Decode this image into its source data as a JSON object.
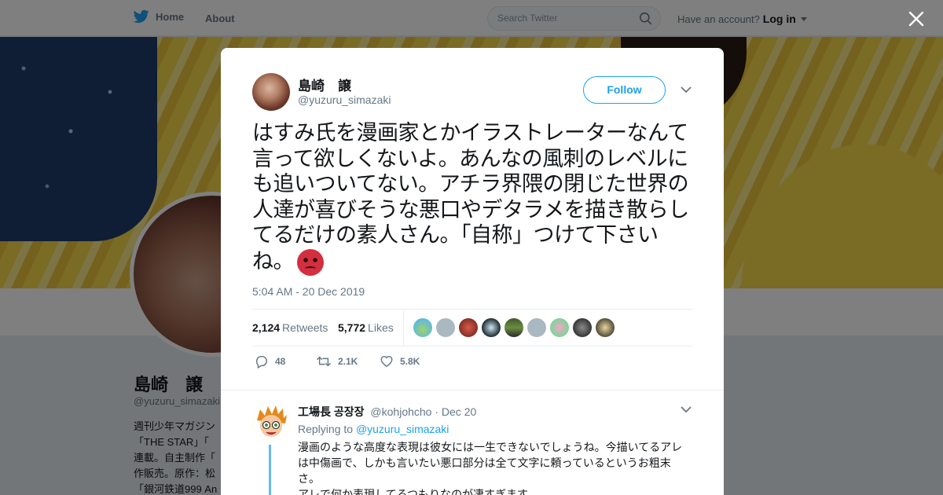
{
  "nav": {
    "home_label": "Home",
    "about_label": "About",
    "search_placeholder": "Search Twitter",
    "account_prompt": "Have an account?",
    "login_label": "Log in"
  },
  "profile": {
    "name": "島崎　譲",
    "handle": "@yuzuru_simazaki",
    "bio": "週刊少年マガジン\n「THE STAR」「\n連載。自主制作「\n作販売。原作：松\n「銀河鉄道999 An"
  },
  "tweet": {
    "author_name": "島崎　譲",
    "author_handle": "@yuzuru_simazaki",
    "follow_label": "Follow",
    "text": "はすみ氏を漫画家とかイラストレーターなんて言って欲しくないよ。あんなの風刺のレベルにも追いついてない。アチラ界隈の閉じた世界の人達が喜びそうな悪口やデタラメを描き散らしてるだけの素人さん。「自称」つけて下さいね。",
    "emoji": "angry-face",
    "timestamp": "5:04 AM - 20 Dec 2019",
    "retweets_count": "2,124",
    "retweets_label": "Retweets",
    "likes_count": "5,772",
    "likes_label": "Likes",
    "actions": {
      "replies": "48",
      "retweets": "2.1K",
      "likes": "5.8K"
    },
    "likers_count": 9
  },
  "reply": {
    "name": "工場長 공장장",
    "handle": "@kohjohcho",
    "date": "· Dec 20",
    "replying_prefix": "Replying to",
    "replying_to": "@yuzuru_simazaki",
    "text": "漫画のような高度な表現は彼女には一生できないでしょうね。今描いてるアレは中傷画で、しかも言いたい悪口部分は全て文字に頼っているというお粗末さ。\nアレで何か表現してるつもりなのが凄すぎます"
  },
  "colors": {
    "brand": "#1da1f2",
    "text": "#14171a",
    "muted": "#657786"
  }
}
